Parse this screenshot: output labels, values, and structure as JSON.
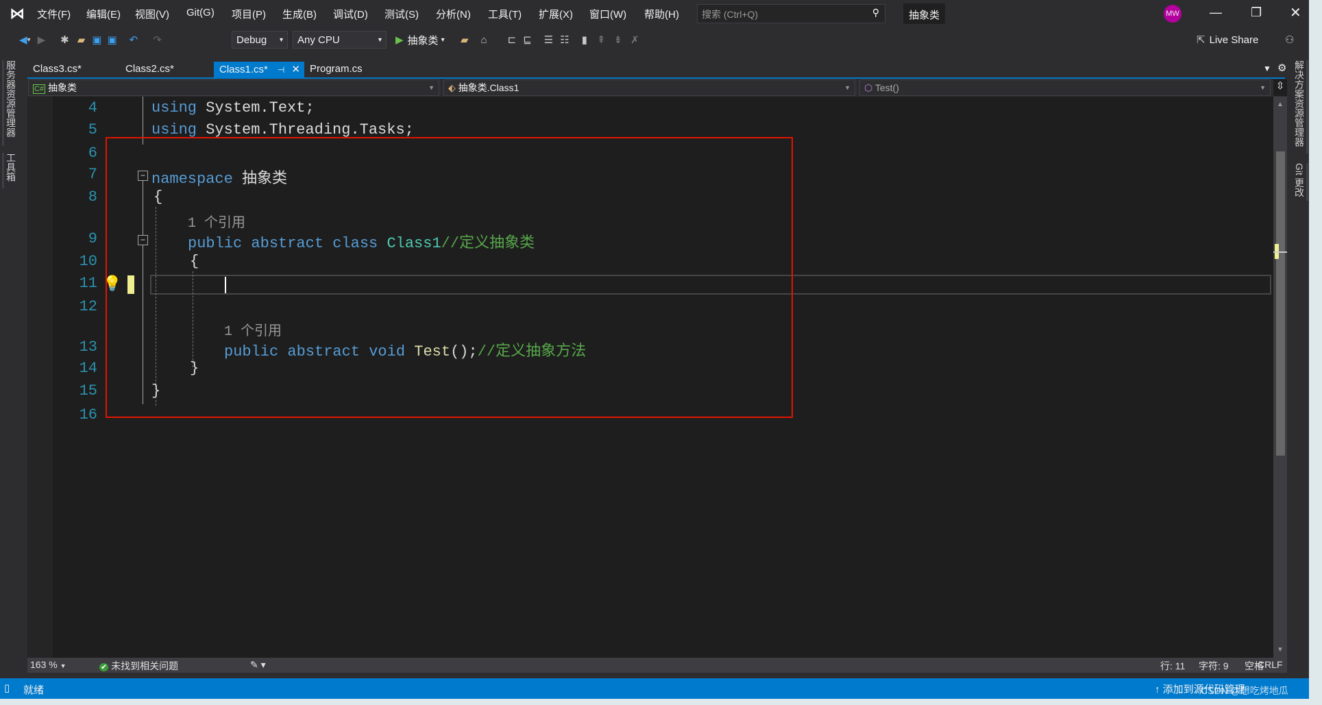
{
  "menu": [
    "文件(F)",
    "编辑(E)",
    "视图(V)",
    "Git(G)",
    "项目(P)",
    "生成(B)",
    "调试(D)",
    "测试(S)",
    "分析(N)",
    "工具(T)",
    "扩展(X)",
    "窗口(W)",
    "帮助(H)"
  ],
  "search": {
    "placeholder": "搜索 (Ctrl+Q)"
  },
  "solution_name": "抽象类",
  "avatar": "MW",
  "toolbar": {
    "config": "Debug",
    "platform": "Any CPU",
    "run_label": "抽象类",
    "live_share": "Live Share"
  },
  "tabs": [
    {
      "label": "Class3.cs*"
    },
    {
      "label": "Class2.cs*"
    },
    {
      "label": "Class1.cs*",
      "active": true
    },
    {
      "label": "Program.cs"
    }
  ],
  "nav": {
    "project": "抽象类",
    "type": "抽象类.Class1",
    "member": "Test()"
  },
  "left_panels": [
    "服务器资源管理器",
    "工具箱"
  ],
  "right_panels": [
    "解决方案资源管理器",
    "Git 更改"
  ],
  "code": {
    "l4": [
      "using",
      " System.Text;"
    ],
    "l5": [
      "using",
      " System.Threading.Tasks;"
    ],
    "l7": [
      "namespace",
      " 抽象类"
    ],
    "l8": "{",
    "lens1": "1 个引用",
    "l9": [
      "public abstract class ",
      "Class1",
      "//定义抽象类"
    ],
    "l10": "{",
    "lens2": "1 个引用",
    "l13": [
      "public abstract void ",
      "Test",
      "();",
      "//定义抽象方法"
    ],
    "l14": "}",
    "l15": "}",
    "line_numbers": [
      "4",
      "5",
      "6",
      "7",
      "8",
      "9",
      "10",
      "11",
      "12",
      "13",
      "14",
      "15",
      "16"
    ]
  },
  "editor_status": {
    "zoom": "163 %",
    "issues": "未找到相关问题",
    "line": "行: 11",
    "col": "字符: 9",
    "spaces": "空格",
    "eol": "CRLF"
  },
  "statusbar": {
    "ready": "就绪",
    "source_control": "添加到源代码管理",
    "watermark": "CSDN @想吃烤地瓜"
  },
  "colors": {
    "accent": "#007acc",
    "highlight": "#e51400"
  }
}
